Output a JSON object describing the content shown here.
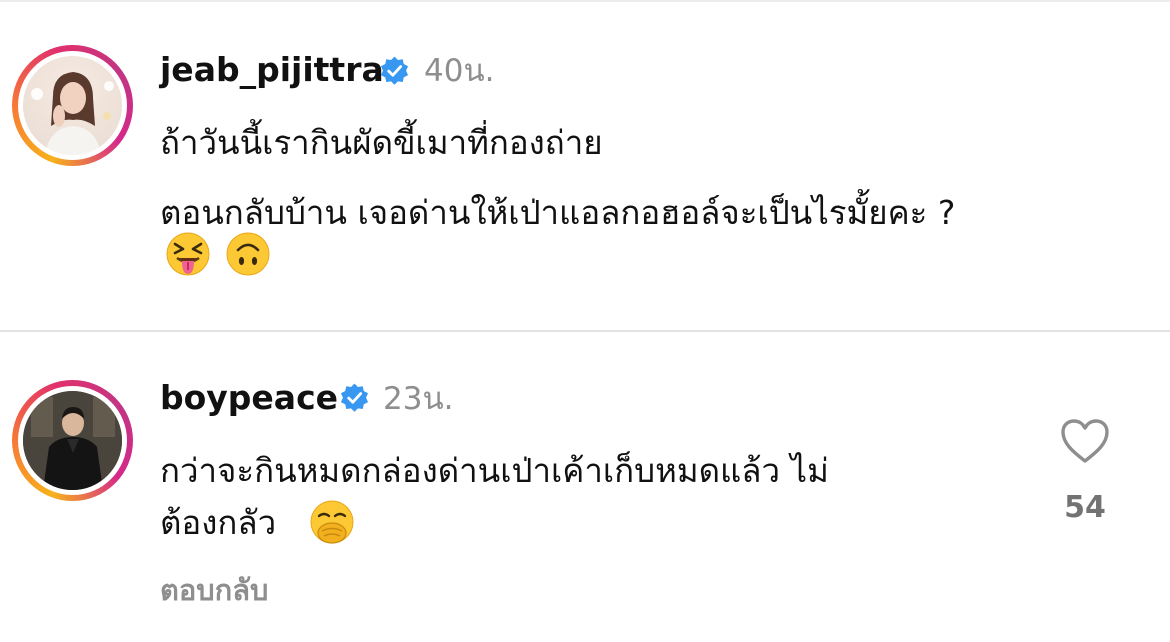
{
  "comments": [
    {
      "username": "jeab_pijittra",
      "verified": true,
      "time": "40น.",
      "lines": [
        "ถ้าวันนี้เรากินผัดขี้เมาที่กองถ่าย",
        "ตอนกลับบ้าน เจอด่านให้เป่าแอลกอฮอล์จะเป็นไรมั้ยคะ ?"
      ],
      "emojis": [
        "squinting-face-with-tongue",
        "upside-down-face"
      ]
    },
    {
      "username": "boypeace",
      "verified": true,
      "time": "23น.",
      "lines": [
        "กว่าจะกินหมดกล่องด่านเป่าเค้าเก็บหมดแล้ว ไม่",
        "ต้องกลัว"
      ],
      "emojis": [
        "face-with-hand-over-mouth"
      ],
      "like_count": "54",
      "reply_label": "ตอบกลับ"
    }
  ],
  "colors": {
    "verified": "#3897f0",
    "secondary_text": "#8e8e8e",
    "like_count": "#737373",
    "divider": "#e3e3e3"
  }
}
